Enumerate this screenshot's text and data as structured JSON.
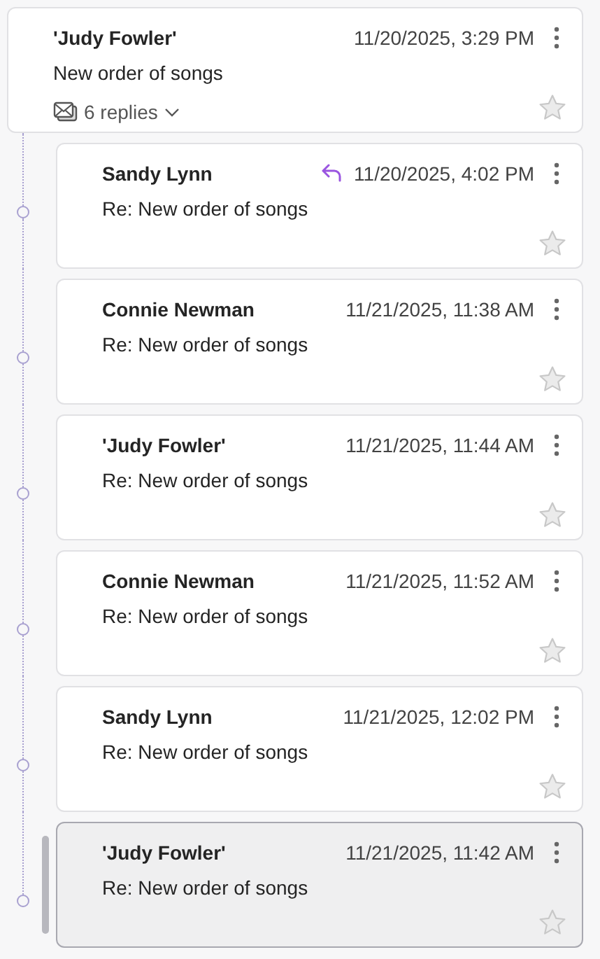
{
  "thread": {
    "root": {
      "sender": "'Judy Fowler'",
      "date": "11/20/2025, 3:29 PM",
      "subject": "New order of songs",
      "replies_label": "6 replies",
      "starred": false
    },
    "replies": [
      {
        "sender": "Sandy Lynn",
        "date": "11/20/2025, 4:02 PM",
        "subject": "Re: New order of songs",
        "replied": true,
        "selected": false,
        "starred": false
      },
      {
        "sender": "Connie Newman",
        "date": "11/21/2025, 11:38 AM",
        "subject": "Re: New order of songs",
        "replied": false,
        "selected": false,
        "starred": false
      },
      {
        "sender": "'Judy Fowler'",
        "date": "11/21/2025, 11:44 AM",
        "subject": "Re: New order of songs",
        "replied": false,
        "selected": false,
        "starred": false
      },
      {
        "sender": "Connie Newman",
        "date": "11/21/2025, 11:52 AM",
        "subject": "Re: New order of songs",
        "replied": false,
        "selected": false,
        "starred": false
      },
      {
        "sender": "Sandy Lynn",
        "date": "11/21/2025, 12:02 PM",
        "subject": "Re: New order of songs",
        "replied": false,
        "selected": false,
        "starred": false
      },
      {
        "sender": "'Judy Fowler'",
        "date": "11/21/2025, 11:42 AM",
        "subject": "Re: New order of songs",
        "replied": false,
        "selected": true,
        "starred": false
      }
    ]
  }
}
